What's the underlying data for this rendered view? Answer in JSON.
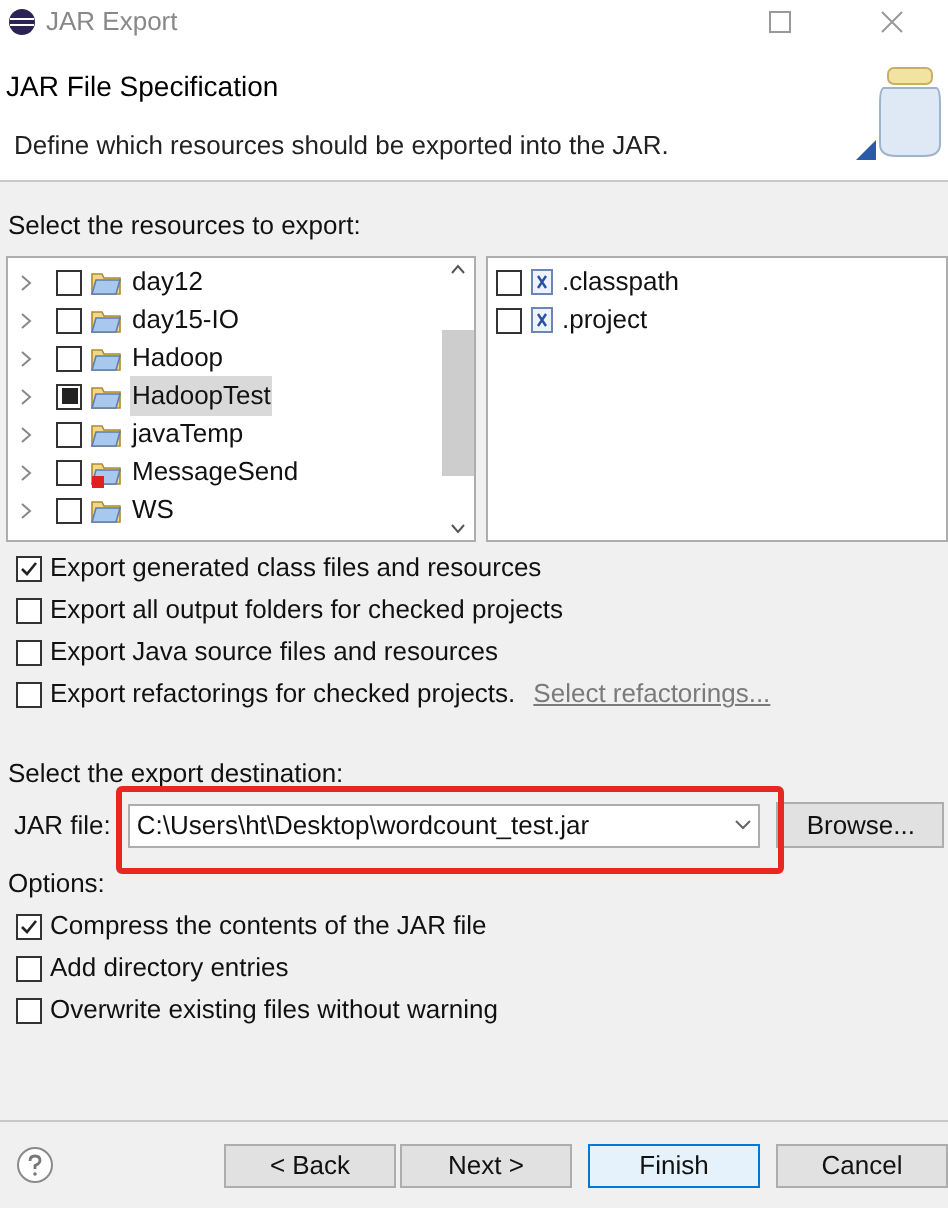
{
  "window": {
    "title": "JAR Export"
  },
  "header": {
    "title": "JAR File Specification",
    "description": "Define which resources should be exported into the JAR."
  },
  "resources": {
    "label": "Select the resources to export:",
    "projects": [
      {
        "name": "day12",
        "checked": false,
        "partial": false,
        "selected": false,
        "error": false
      },
      {
        "name": "day15-IO",
        "checked": false,
        "partial": false,
        "selected": false,
        "error": false
      },
      {
        "name": "Hadoop",
        "checked": false,
        "partial": false,
        "selected": false,
        "error": false
      },
      {
        "name": "HadoopTest",
        "checked": false,
        "partial": true,
        "selected": true,
        "error": false
      },
      {
        "name": "javaTemp",
        "checked": false,
        "partial": false,
        "selected": false,
        "error": false
      },
      {
        "name": "MessageSend",
        "checked": false,
        "partial": false,
        "selected": false,
        "error": true
      },
      {
        "name": "WS",
        "checked": false,
        "partial": false,
        "selected": false,
        "error": false
      }
    ],
    "files": [
      {
        "name": ".classpath",
        "checked": false
      },
      {
        "name": ".project",
        "checked": false
      }
    ]
  },
  "export_options": [
    {
      "label": "Export generated class files and resources",
      "checked": true
    },
    {
      "label": "Export all output folders for checked projects",
      "checked": false
    },
    {
      "label": "Export Java source files and resources",
      "checked": false
    },
    {
      "label": "Export refactorings for checked projects.",
      "checked": false,
      "link": "Select refactorings..."
    }
  ],
  "destination": {
    "label": "Select the export destination:",
    "field_label": "JAR file:",
    "value": "C:\\Users\\ht\\Desktop\\wordcount_test.jar",
    "browse": "Browse..."
  },
  "annotation": {
    "kind": "rectangle",
    "color": "#e8281e"
  },
  "options": {
    "label": "Options:",
    "items": [
      {
        "label": "Compress the contents of the JAR file",
        "checked": true
      },
      {
        "label": "Add directory entries",
        "checked": false
      },
      {
        "label": "Overwrite existing files without warning",
        "checked": false
      }
    ]
  },
  "buttons": [
    {
      "label": "< Back",
      "default": false
    },
    {
      "label": "Next >",
      "default": false
    },
    {
      "label": "Finish",
      "default": true
    },
    {
      "label": "Cancel",
      "default": false
    }
  ]
}
